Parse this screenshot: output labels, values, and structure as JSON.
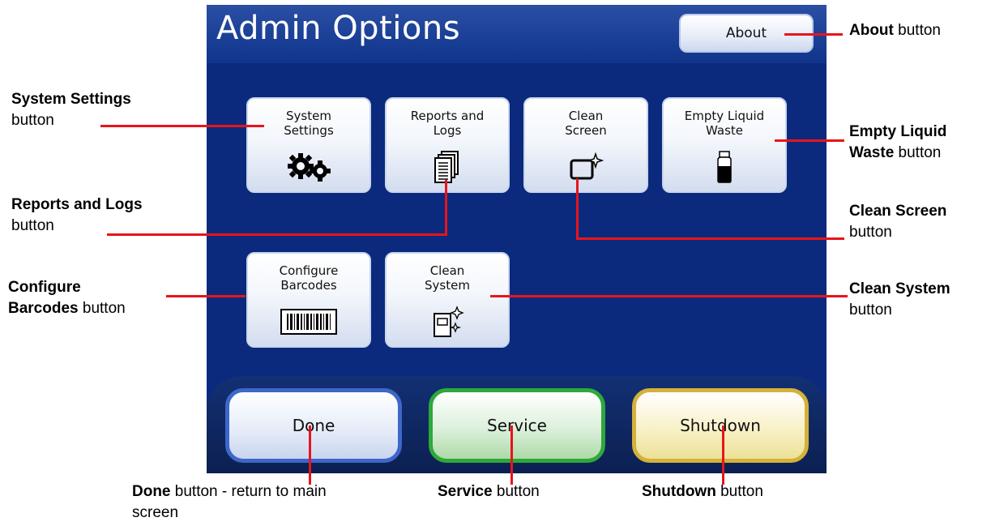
{
  "screen": {
    "title": "Admin Options",
    "about_label": "About",
    "tiles": [
      {
        "label": "System\nSettings",
        "icon": "gears-icon"
      },
      {
        "label": "Reports and\nLogs",
        "icon": "document-stack-icon"
      },
      {
        "label": "Clean\nScreen",
        "icon": "clean-screen-icon"
      },
      {
        "label": "Empty Liquid\nWaste",
        "icon": "waste-bottle-icon"
      },
      {
        "label": "Configure\nBarcodes",
        "icon": "barcode-icon"
      },
      {
        "label": "Clean\nSystem",
        "icon": "clean-system-icon"
      }
    ],
    "bottom_buttons": {
      "done": "Done",
      "service": "Service",
      "shutdown": "Shutdown"
    }
  },
  "annotations": {
    "about": {
      "bold": "About",
      "rest": " button"
    },
    "system_settings": {
      "bold": "System Settings",
      "rest": "button"
    },
    "reports_logs": {
      "bold": "Reports and Logs",
      "rest": "button"
    },
    "configure_barcodes": {
      "bold1": "Configure",
      "bold2": "Barcodes",
      "rest": " button"
    },
    "empty_liquid": {
      "bold1": "Empty Liquid",
      "bold2": "Waste",
      "rest": " button"
    },
    "clean_screen": {
      "bold": "Clean Screen",
      "rest": "button"
    },
    "clean_system": {
      "bold": "Clean System",
      "rest": "button"
    },
    "done": {
      "bold": "Done",
      "rest1": " button - return to main",
      "rest2": "screen"
    },
    "service": {
      "bold": "Service",
      "rest": " button"
    },
    "shutdown": {
      "bold": "Shutdown",
      "rest": " button"
    }
  },
  "colors": {
    "screen_bg": "#0b2a7d",
    "callout_line": "#e8141b",
    "done_border": "#3d67c9",
    "service_border": "#2ea83a",
    "shutdown_border": "#d4b13a"
  }
}
